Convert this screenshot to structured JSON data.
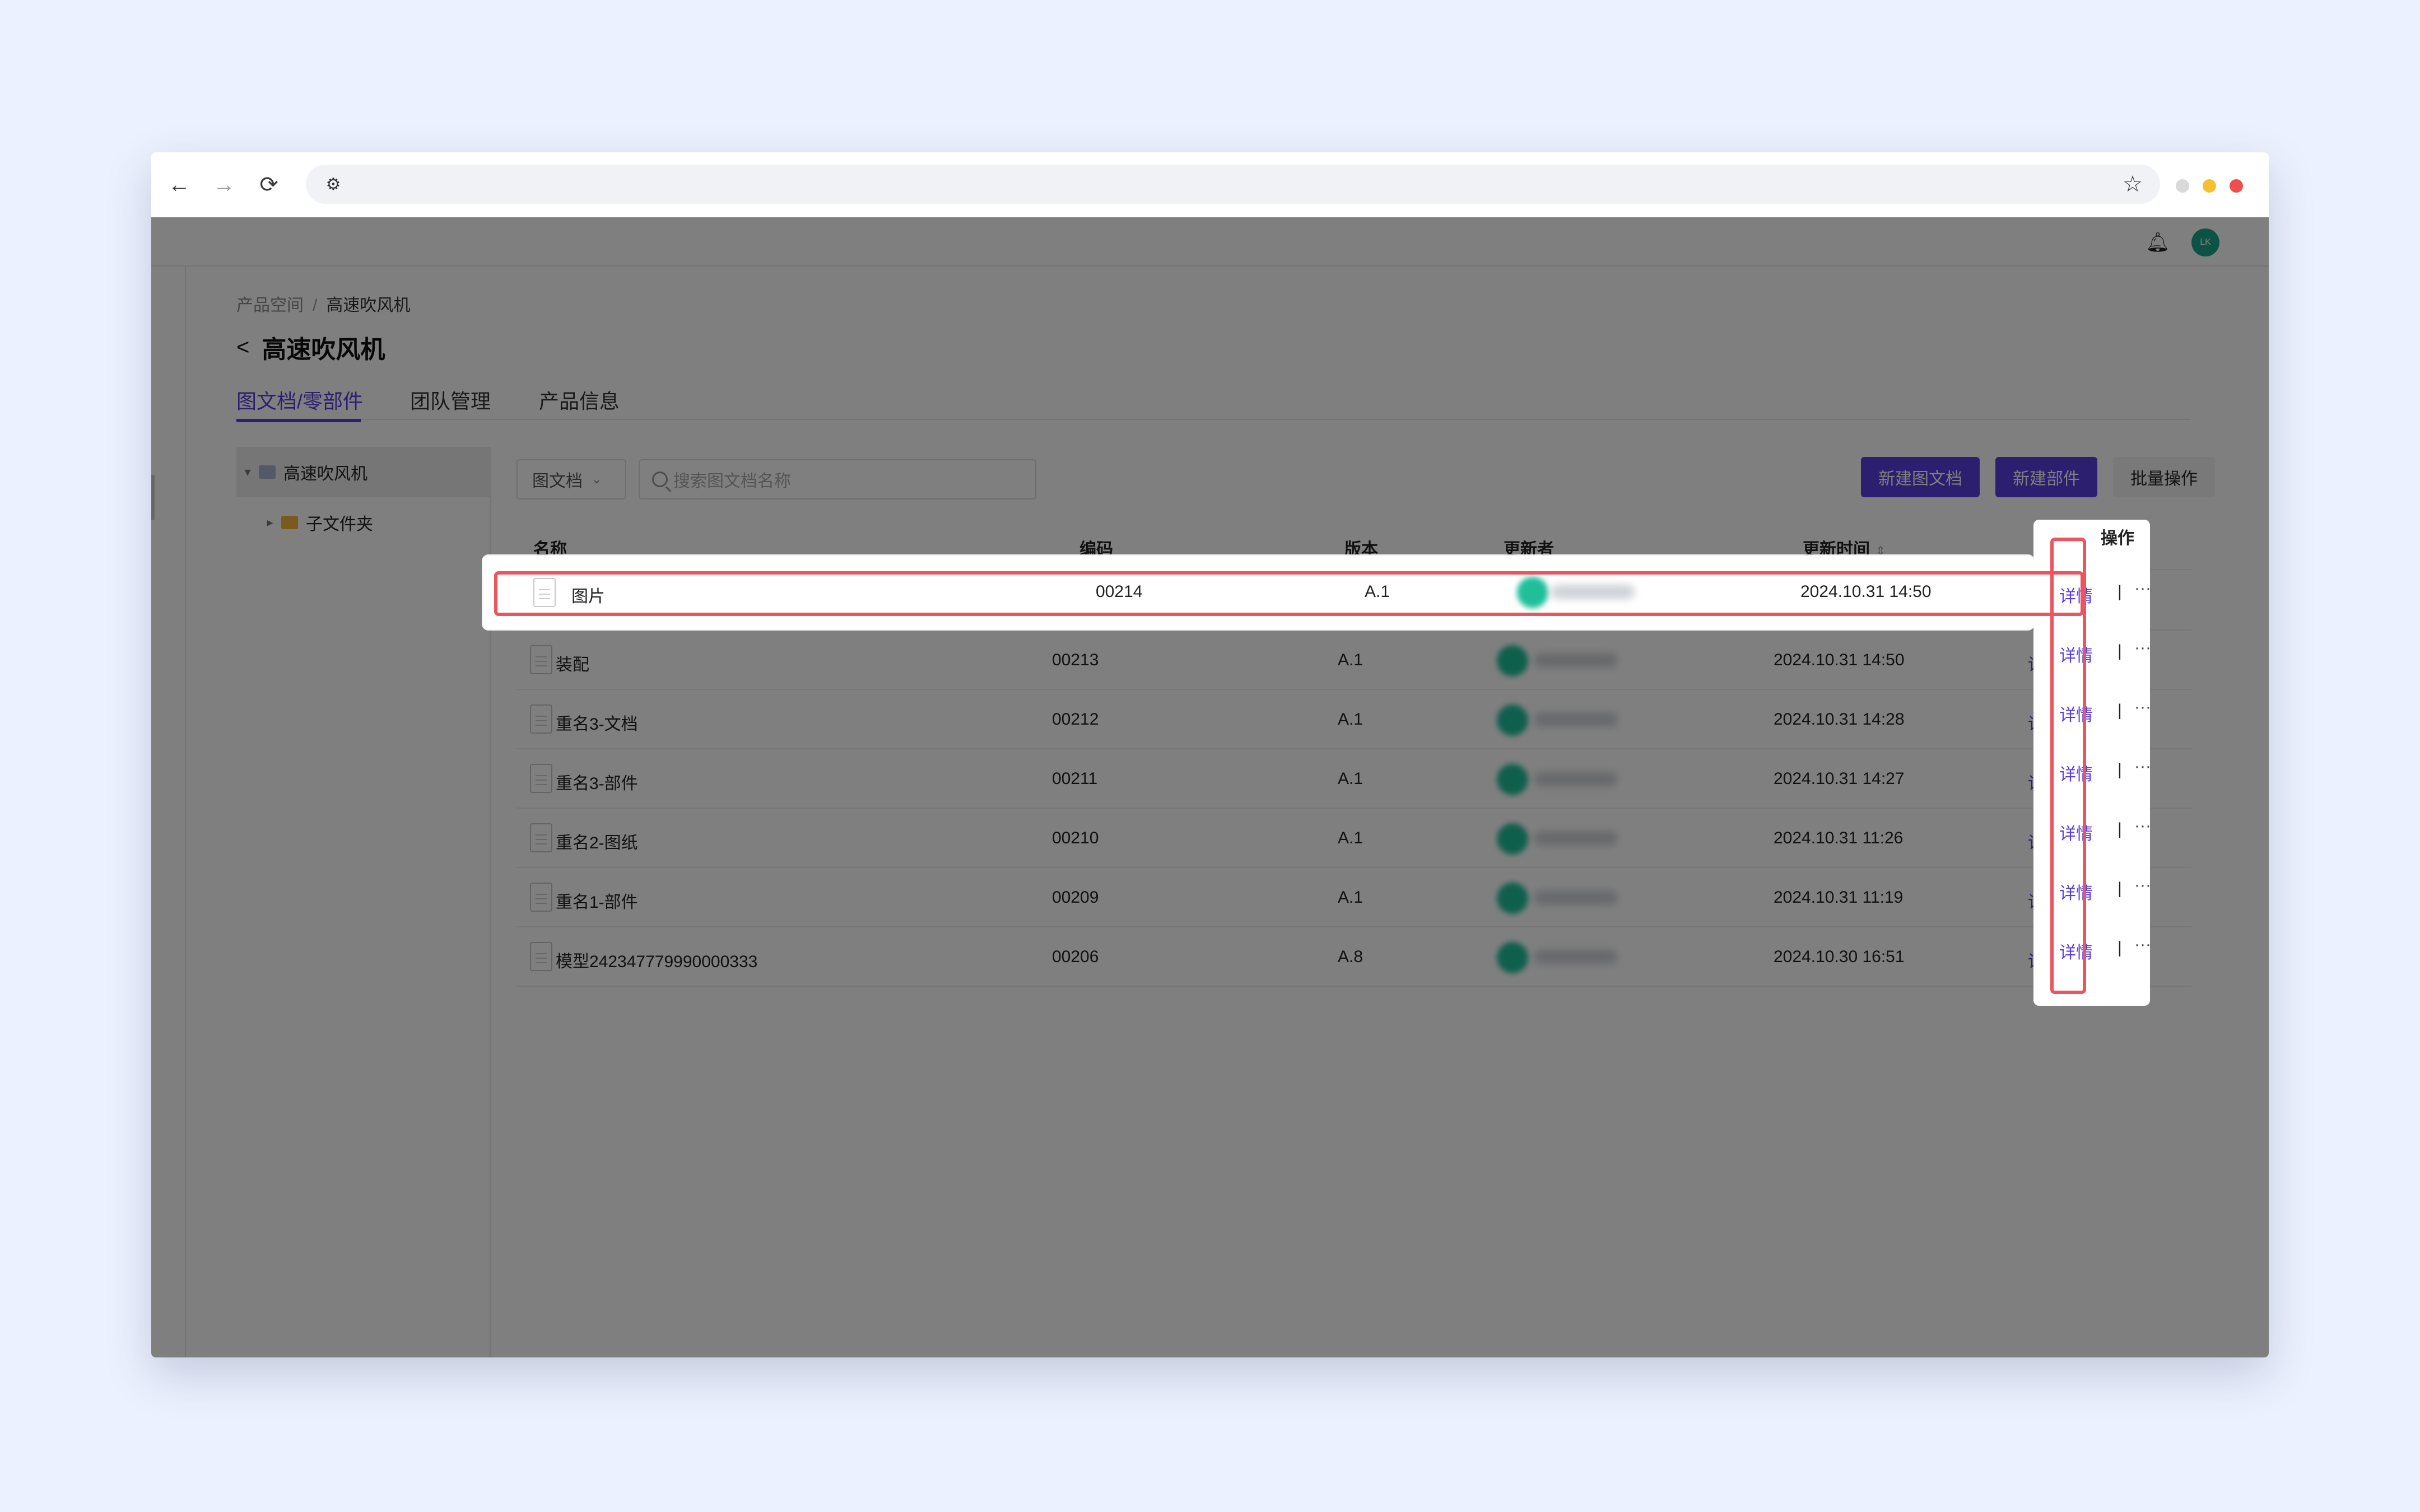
{
  "browser": {
    "nav": {
      "back": "←",
      "forward": "→",
      "reload": "⟳"
    },
    "url": ""
  },
  "app": {
    "breadcrumb": [
      "产品空间",
      "高速吹风机"
    ],
    "page_title": "高速吹风机",
    "tabs": [
      {
        "label": "图文档/零部件",
        "active": true
      },
      {
        "label": "团队管理",
        "active": false
      },
      {
        "label": "产品信息",
        "active": false
      }
    ],
    "tree": {
      "root": "高速吹风机",
      "children": [
        "子文件夹"
      ]
    },
    "filter": {
      "type_select": "图文档",
      "search_placeholder": "搜索图文档名称"
    },
    "buttons": {
      "new_doc": "新建图文档",
      "new_part": "新建部件",
      "batch": "批量操作"
    },
    "avatar_initials": "LK",
    "table": {
      "headers": {
        "name": "名称",
        "code": "编码",
        "version": "版本",
        "updater": "更新者",
        "updated_at": "更新时间",
        "actions": "操作"
      },
      "action_detail": "详情",
      "action_sep": "|",
      "action_more": "···",
      "rows": [
        {
          "name": "图片",
          "code": "00214",
          "version": "A.1",
          "updated_at": "2024.10.31 14:50"
        },
        {
          "name": "装配",
          "code": "00213",
          "version": "A.1",
          "updated_at": "2024.10.31 14:50"
        },
        {
          "name": "重名3-文档",
          "code": "00212",
          "version": "A.1",
          "updated_at": "2024.10.31 14:28"
        },
        {
          "name": "重名3-部件",
          "code": "00211",
          "version": "A.1",
          "updated_at": "2024.10.31 14:27"
        },
        {
          "name": "重名2-图纸",
          "code": "00210",
          "version": "A.1",
          "updated_at": "2024.10.31 11:26"
        },
        {
          "name": "重名1-部件",
          "code": "00209",
          "version": "A.1",
          "updated_at": "2024.10.31 11:19"
        },
        {
          "name": "模型242347779990000333",
          "code": "00206",
          "version": "A.8",
          "updated_at": "2024.10.30 16:51"
        }
      ]
    }
  },
  "colors": {
    "accent": "#5b3ee0",
    "highlight": "#ec5560",
    "background": "#ebf1fe"
  }
}
